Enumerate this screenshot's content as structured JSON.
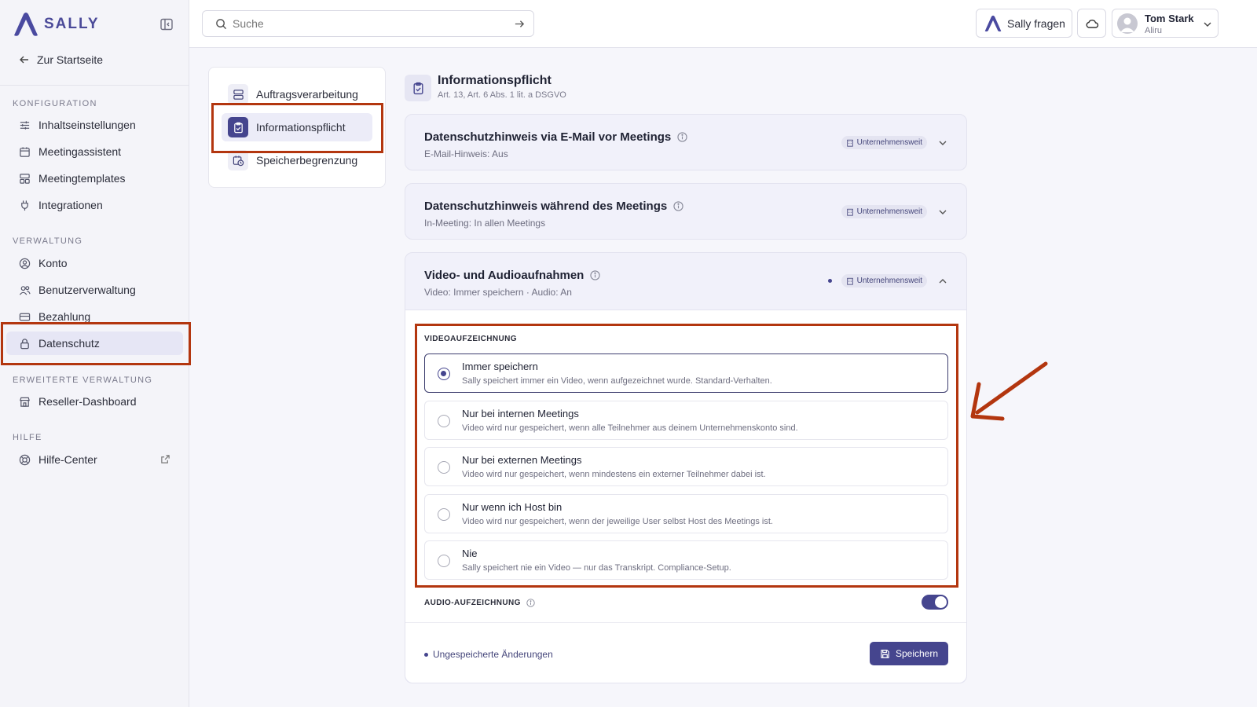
{
  "brand": {
    "name": "SALLY",
    "accent": "#45458e",
    "annotation_color": "#b3360f"
  },
  "sidebar": {
    "back_label": "Zur Startseite",
    "sections": {
      "konfiguration": "KONFIGURATION",
      "verwaltung": "VERWALTUNG",
      "erweitert": "ERWEITERTE VERWALTUNG",
      "hilfe": "HILFE"
    },
    "items": [
      {
        "label": "Inhaltseinstellungen",
        "icon": "sliders-icon"
      },
      {
        "label": "Meetingassistent",
        "icon": "calendar-icon"
      },
      {
        "label": "Meetingtemplates",
        "icon": "template-icon"
      },
      {
        "label": "Integrationen",
        "icon": "plug-icon"
      },
      {
        "label": "Konto",
        "icon": "user-circle-icon"
      },
      {
        "label": "Benutzerverwaltung",
        "icon": "users-icon"
      },
      {
        "label": "Bezahlung",
        "icon": "credit-card-icon"
      },
      {
        "label": "Datenschutz",
        "icon": "lock-icon",
        "active": true
      },
      {
        "label": "Reseller-Dashboard",
        "icon": "store-icon"
      },
      {
        "label": "Hilfe-Center",
        "icon": "lifebuoy-icon",
        "external": true
      }
    ]
  },
  "topbar": {
    "search_placeholder": "Suche",
    "ask_label": "Sally fragen",
    "user_name": "Tom Stark",
    "user_org": "Aliru"
  },
  "subnav": {
    "items": [
      {
        "label": "Auftragsverarbeitung",
        "icon": "server-icon"
      },
      {
        "label": "Informationspflicht",
        "icon": "clipboard-check-icon",
        "active": true
      },
      {
        "label": "Speicherbegrenzung",
        "icon": "calendar-clock-icon"
      }
    ]
  },
  "main": {
    "title": "Informationspflicht",
    "subtitle": "Art. 13, Art. 6 Abs. 1 lit. a DSGVO",
    "sections": [
      {
        "title": "Datenschutzhinweis via E-Mail vor Meetings",
        "summary": "E-Mail-Hinweis: Aus",
        "badge": "Unternehmensweit",
        "expanded": false
      },
      {
        "title": "Datenschutzhinweis während des Meetings",
        "summary": "In-Meeting: In allen Meetings",
        "badge": "Unternehmensweit",
        "expanded": false
      },
      {
        "title": "Video- und Audioaufnahmen",
        "summary": "Video: Immer speichern · Audio: An",
        "badge": "Unternehmensweit",
        "expanded": true
      }
    ],
    "video": {
      "label": "VIDEOAUFZEICHNUNG",
      "selected": 0,
      "options": [
        {
          "label": "Immer speichern",
          "desc": "Sally speichert immer ein Video, wenn aufgezeichnet wurde. Standard-Verhalten."
        },
        {
          "label": "Nur bei internen Meetings",
          "desc": "Video wird nur gespeichert, wenn alle Teilnehmer aus deinem Unternehmenskonto sind."
        },
        {
          "label": "Nur bei externen Meetings",
          "desc": "Video wird nur gespeichert, wenn mindestens ein externer Teilnehmer dabei ist."
        },
        {
          "label": "Nur wenn ich Host bin",
          "desc": "Video wird nur gespeichert, wenn der jeweilige User selbst Host des Meetings ist."
        },
        {
          "label": "Nie",
          "desc": "Sally speichert nie ein Video — nur das Transkript. Compliance-Setup."
        }
      ]
    },
    "audio": {
      "label": "AUDIO-AUFZEICHNUNG",
      "enabled": true
    },
    "footer": {
      "unsaved": "Ungespeicherte Änderungen",
      "save_label": "Speichern"
    }
  }
}
